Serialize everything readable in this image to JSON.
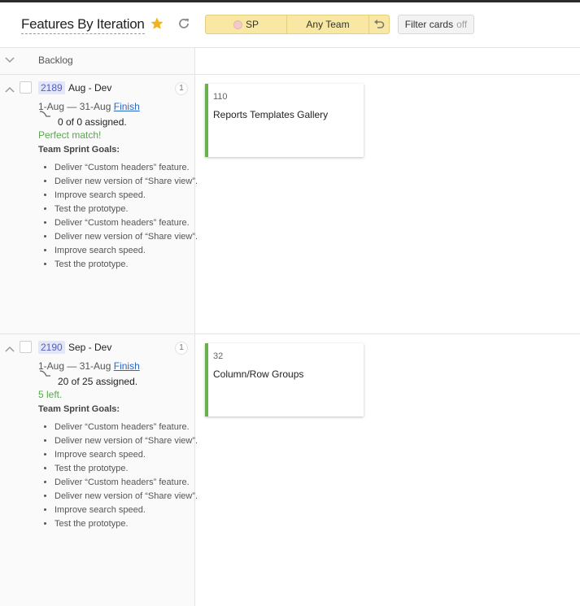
{
  "header": {
    "title": "Features By Iteration",
    "sp_label": "SP",
    "team_label": "Any Team",
    "filter_label": "Filter cards",
    "filter_state": "off"
  },
  "backlog": {
    "label": "Backlog"
  },
  "iterations": [
    {
      "id": "2189",
      "name": "Aug - Dev",
      "count": "1",
      "dates": "1-Aug — 31-Aug",
      "finish": "Finish",
      "assigned": "0 of 0 assigned.",
      "note": "Perfect match!",
      "goals_title": "Team Sprint Goals:",
      "goals": [
        "Deliver “Custom headers” feature.",
        "Deliver new version of “Share view”.",
        "Improve search speed.",
        "Test the prototype.",
        "Deliver “Custom headers” feature.",
        "Deliver new version of “Share view”.",
        "Improve search speed.",
        "Test the prototype."
      ],
      "card": {
        "id": "110",
        "title": "Reports Templates Gallery"
      }
    },
    {
      "id": "2190",
      "name": "Sep - Dev",
      "count": "1",
      "dates": "1-Aug — 31-Aug",
      "finish": "Finish",
      "assigned": "20 of 25 assigned.",
      "note": "5 left.",
      "goals_title": "Team Sprint Goals:",
      "goals": [
        "Deliver “Custom headers” feature.",
        "Deliver new version of “Share view”.",
        "Improve search speed.",
        "Test the prototype.",
        "Deliver “Custom headers” feature.",
        "Deliver new version of “Share view”.",
        "Improve search speed.",
        "Test the prototype."
      ],
      "card": {
        "id": "32",
        "title": "Column/Row Groups"
      }
    }
  ],
  "colors": {
    "accent_yellow": "#f8e8a4",
    "card_border": "#6ab04c",
    "badge_bg": "#e3e6f8",
    "link": "#2a67c9",
    "success": "#59a64f"
  },
  "icons": [
    "star-icon",
    "refresh-icon",
    "undo-icon",
    "chevron-down-icon",
    "chevron-up-icon",
    "assign-arrow-icon"
  ]
}
